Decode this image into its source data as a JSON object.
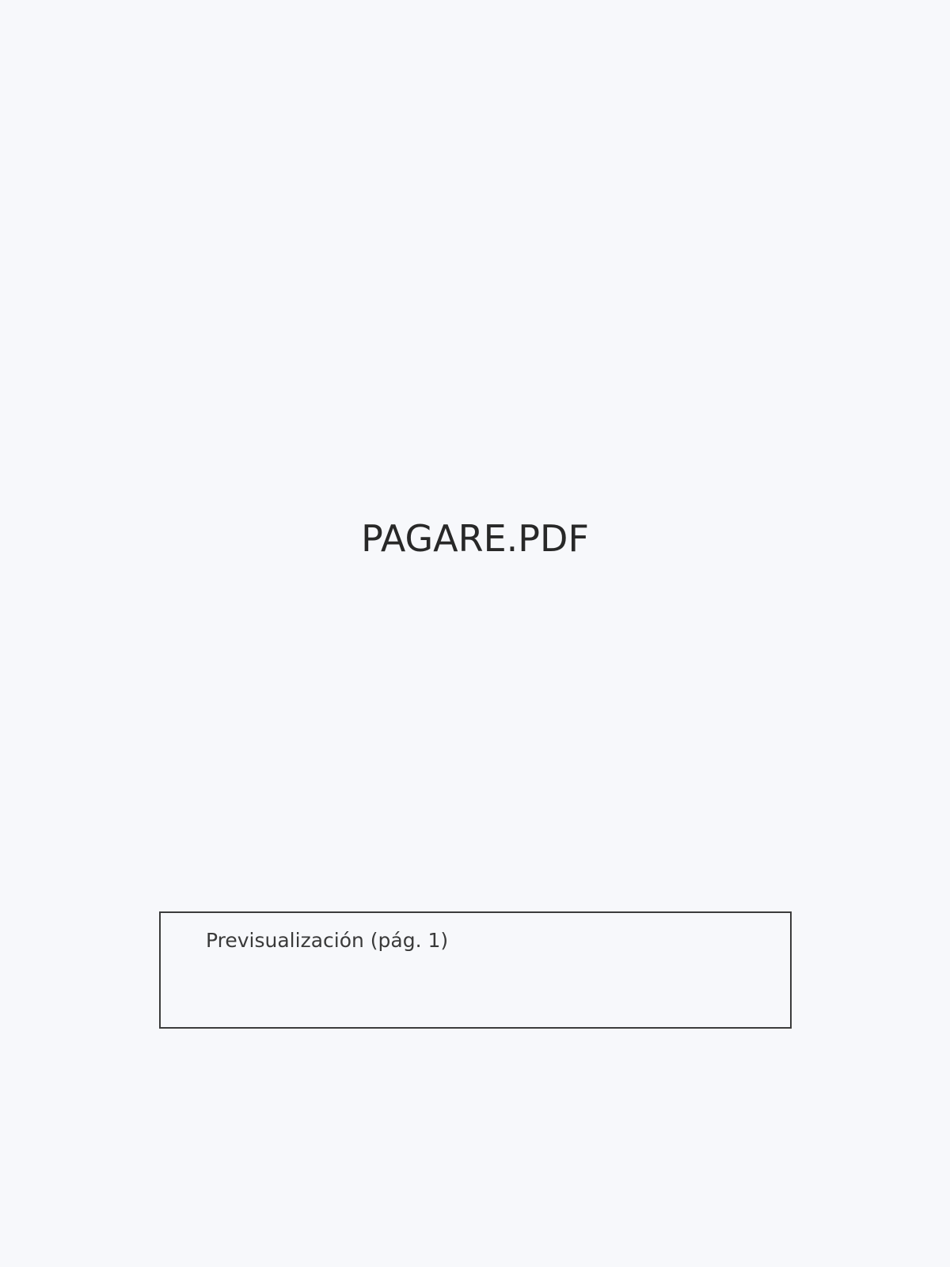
{
  "document": {
    "filename": "PAGARE.PDF",
    "preview_label": "Previsualización (pág. 1)"
  },
  "colors": {
    "background": "#f7f8fb",
    "text": "#282828",
    "border": "#3c3c3c"
  }
}
